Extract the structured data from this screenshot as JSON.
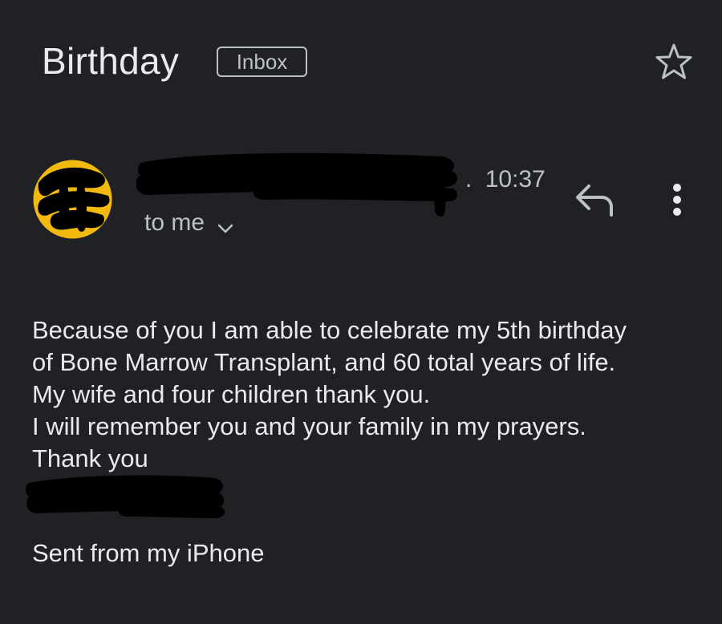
{
  "header": {
    "subject": "Birthday",
    "label": "Inbox",
    "star_icon": "star-outline-icon"
  },
  "message": {
    "time_prefix": ".",
    "time": "10:37",
    "recipient": "to me",
    "recipient_icon": "chevron-down-icon",
    "actions": {
      "reply_icon": "reply-icon",
      "more_icon": "more-vert-icon"
    },
    "body_lines": [
      "Because of you I am able to celebrate my 5th birthday",
      "of Bone Marrow Transplant, and 60 total years of life.",
      "My wife and four children thank you.",
      "I will remember you and your family in my prayers.",
      "Thank you"
    ],
    "signature_footer": "Sent from my iPhone"
  },
  "colors": {
    "background": "#202124",
    "text_primary": "#e8eaed",
    "text_secondary": "#bdc1c6",
    "avatar_yellow": "#f2b90f",
    "redaction": "#000000"
  }
}
